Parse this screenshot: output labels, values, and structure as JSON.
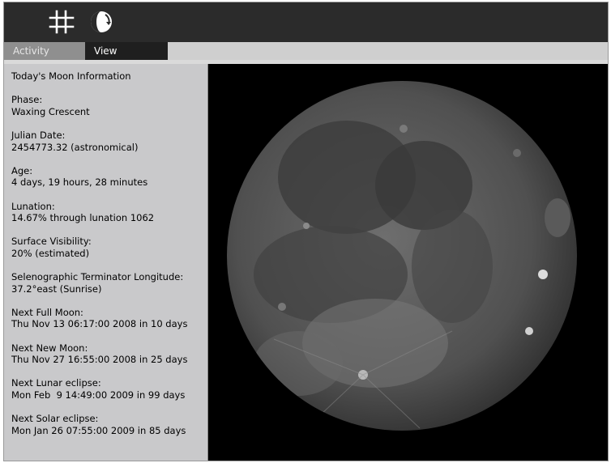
{
  "toolbar": {
    "buttons": [
      {
        "name": "grid-icon"
      },
      {
        "name": "moon-phase-icon"
      }
    ]
  },
  "tabs": [
    {
      "label": "Activity",
      "selected": false
    },
    {
      "label": "View",
      "selected": true
    }
  ],
  "info": {
    "title": "Today's Moon Information",
    "items": [
      {
        "label": "Phase:",
        "value": "Waxing Crescent"
      },
      {
        "label": "Julian Date:",
        "value": "2454773.32 (astronomical)"
      },
      {
        "label": "Age:",
        "value": "4 days, 19 hours, 28 minutes"
      },
      {
        "label": "Lunation:",
        "value": "14.67% through lunation 1062"
      },
      {
        "label": "Surface Visibility:",
        "value": "20% (estimated)"
      },
      {
        "label": "Selenographic Terminator Longitude:",
        "value": "37.2°east (Sunrise)"
      },
      {
        "label": "Next Full Moon:",
        "value": "Thu Nov 13 06:17:00 2008 in 10 days"
      },
      {
        "label": "Next New Moon:",
        "value": "Thu Nov 27 16:55:00 2008 in 25 days"
      },
      {
        "label": "Next Lunar eclipse:",
        "value": "Mon Feb  9 14:49:00 2009 in 99 days"
      },
      {
        "label": "Next Solar eclipse:",
        "value": "Mon Jan 26 07:55:00 2009 in 85 days"
      }
    ]
  },
  "colors": {
    "toolbar": "#2b2b2b",
    "panel": "#c9c9cb",
    "tab_selected": "#1f1f1f",
    "tab_unselected": "#8f8f8f"
  }
}
